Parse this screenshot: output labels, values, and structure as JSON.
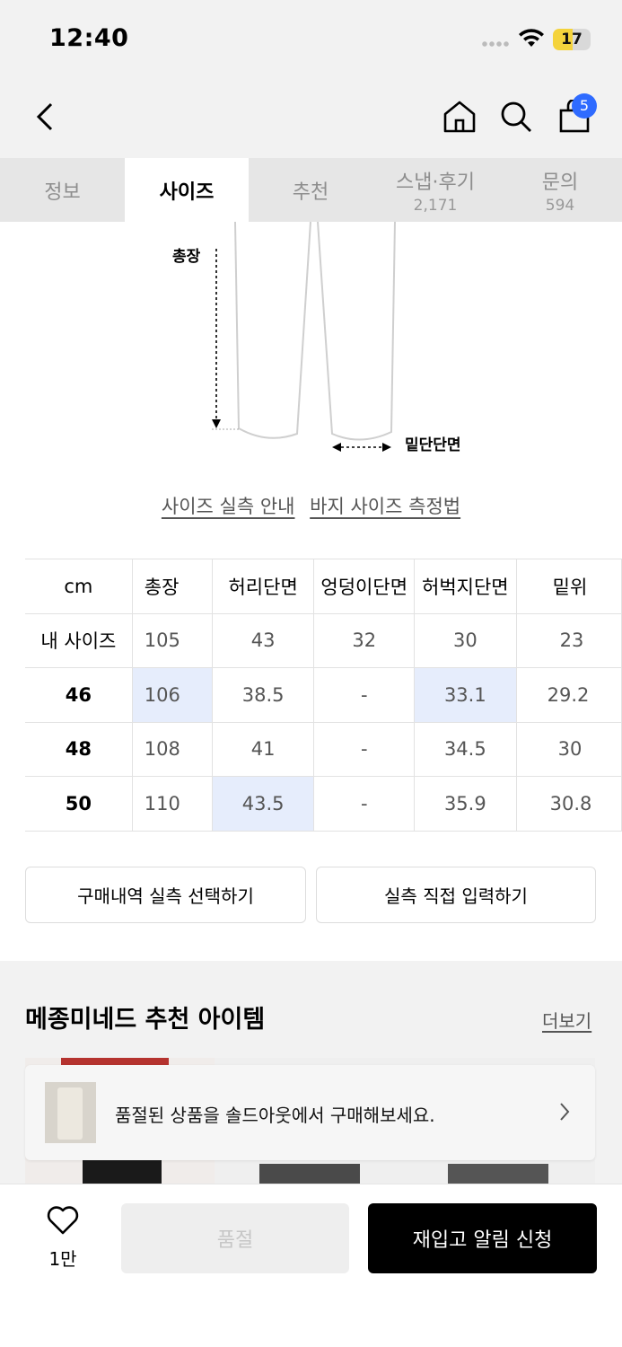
{
  "status_bar": {
    "time": "12:40",
    "battery": "17"
  },
  "header": {
    "cart_count": "5"
  },
  "tabs": [
    {
      "label": "정보",
      "count": ""
    },
    {
      "label": "사이즈",
      "count": ""
    },
    {
      "label": "추천",
      "count": ""
    },
    {
      "label": "스냅·후기",
      "count": "2,171"
    },
    {
      "label": "문의",
      "count": "594"
    }
  ],
  "diagram": {
    "length_label": "총장",
    "hem_label": "밑단단면"
  },
  "links": {
    "size_guide": "사이즈 실측 안내",
    "measure_guide": "바지 사이즈 측정법"
  },
  "size_table": {
    "headers": [
      "cm",
      "총장",
      "허리단면",
      "엉덩이단면",
      "허벅지단면",
      "밑위"
    ],
    "rows": [
      [
        "내 사이즈",
        "105",
        "43",
        "32",
        "30",
        "23"
      ],
      [
        "46",
        "106",
        "38.5",
        "-",
        "33.1",
        "29.2"
      ],
      [
        "48",
        "108",
        "41",
        "-",
        "34.5",
        "30"
      ],
      [
        "50",
        "110",
        "43.5",
        "-",
        "35.9",
        "30.8"
      ]
    ]
  },
  "actions": {
    "select_purchase": "구매내역 실측 선택하기",
    "direct_input": "실측 직접 입력하기"
  },
  "recommend": {
    "title": "메종미네드 추천 아이템",
    "more": "더보기"
  },
  "toast": {
    "message": "품절된 상품을 솔드아웃에서 구매해보세요."
  },
  "bottom": {
    "likes": "1만",
    "soldout": "품절",
    "restock": "재입고 알림 신청"
  },
  "colors": {
    "highlight": "#e6edfc",
    "badge": "#2f6bff",
    "primary": "#000000"
  }
}
